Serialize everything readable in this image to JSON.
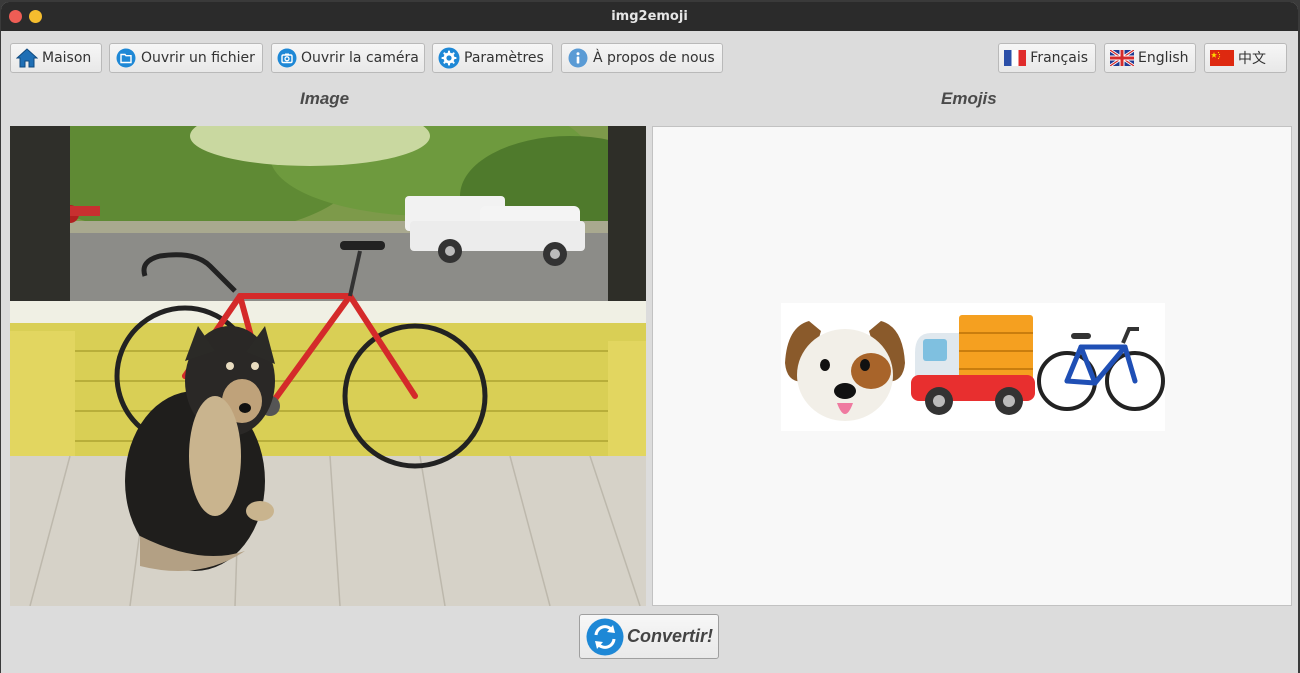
{
  "window": {
    "title": "img2emoji"
  },
  "toolbar": {
    "home_label": "Maison",
    "open_file_label": "Ouvrir un fichier",
    "open_camera_label": "Ouvrir la caméra",
    "settings_label": "Paramètres",
    "about_label": "À propos de nous"
  },
  "languages": {
    "french_label": "Français",
    "english_label": "English",
    "chinese_label": "中文"
  },
  "panels": {
    "image_heading": "Image",
    "emojis_heading": "Emojis"
  },
  "emojis": [
    "dog-face-emoji",
    "delivery-truck-emoji",
    "bicycle-emoji"
  ],
  "actions": {
    "convert_label": "Convertir!"
  },
  "colors": {
    "titlebar": "#2b2b2b",
    "window_bg": "#dcdcdc",
    "accent_blue": "#1e88d6",
    "close_dot": "#ee5d55",
    "min_dot": "#f5bd2e"
  }
}
